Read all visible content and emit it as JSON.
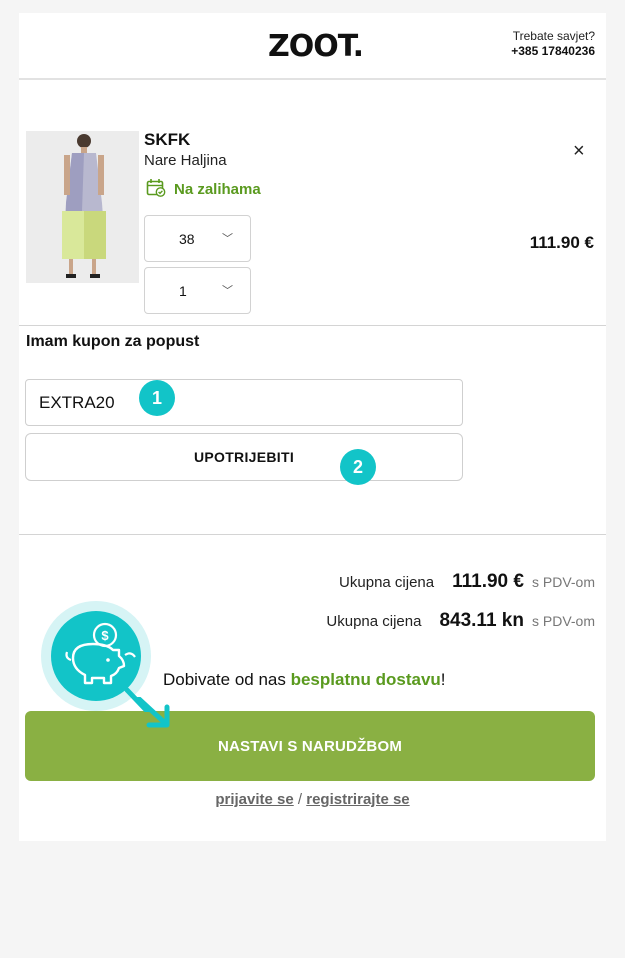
{
  "header": {
    "logo": "ZOOT.",
    "help_question": "Trebate savjet?",
    "help_phone": "+385 17840236"
  },
  "product": {
    "brand": "SKFK",
    "name": "Nare Haljina",
    "stock_label": "Na zalihama",
    "size_value": "38",
    "quantity_value": "1",
    "price": "111.90 €",
    "remove_symbol": "×"
  },
  "coupon": {
    "title": "Imam kupon za popust",
    "input_value": "EXTRA20",
    "apply_label": "UPOTRIJEBITI",
    "badge_1": "1",
    "badge_2": "2"
  },
  "totals": [
    {
      "label": "Ukupna cijena",
      "value": "111.90 €",
      "tax": "s PDV-om"
    },
    {
      "label": "Ukupna cijena",
      "value": "843.11 kn",
      "tax": "s PDV-om"
    }
  ],
  "delivery": {
    "prefix": "Dobivate od nas ",
    "highlight": "besplatnu dostavu",
    "suffix": "!"
  },
  "cta": {
    "label": "NASTAVI S NARUDŽBOM"
  },
  "auth": {
    "login": "prijavite se",
    "separator": " / ",
    "register": "registrirajte se"
  },
  "colors": {
    "accent_green": "#8ab043",
    "stock_green": "#5a9a1f",
    "badge_teal": "#12c4c8"
  },
  "icons": [
    "close-icon",
    "stock-check-icon",
    "chevron-down-icon",
    "piggy-bank-icon",
    "arrow-icon"
  ]
}
